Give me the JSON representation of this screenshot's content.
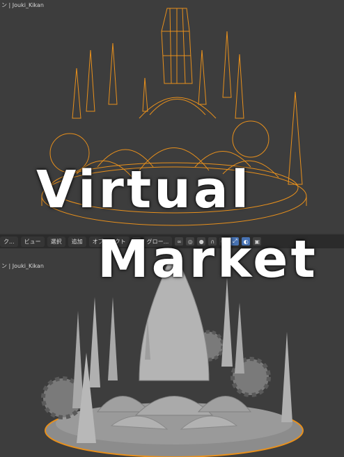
{
  "top_viewport": {
    "label": "ン | Jouki_Kikan"
  },
  "bottom_viewport": {
    "label": "ン | Jouki_Kikan"
  },
  "toolbar": {
    "mode": "ク...",
    "view": "ビュー",
    "select": "選択",
    "add": "追加",
    "object": "オブジェクト",
    "transform": "グロー..."
  },
  "overlay": {
    "line1": "Virtual",
    "line2": "Market"
  },
  "colors": {
    "wire": "#e8901c",
    "solid": "#a8a8a8",
    "bg": "#3d3d3d"
  }
}
